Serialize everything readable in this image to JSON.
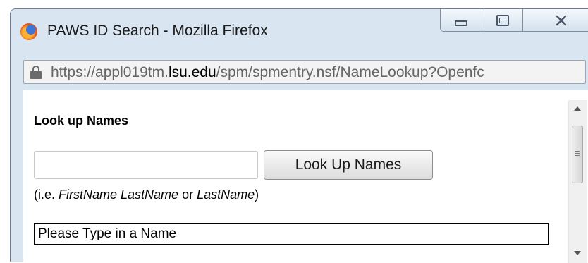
{
  "window": {
    "title": "PAWS ID Search - Mozilla Firefox",
    "icon": "firefox-icon"
  },
  "address_bar": {
    "url_prefix": "https://appl019tm.",
    "url_host": "lsu.edu",
    "url_path": "/spm/spmentry.nsf/NameLookup?Openfc",
    "icon": "lock-icon"
  },
  "page": {
    "heading": "Look up Names",
    "search_value": "",
    "button_label": "Look Up Names",
    "hint": {
      "prefix": "(i.e. ",
      "first_last": "FirstName LastName",
      "or": " or ",
      "last": "LastName",
      "suffix": ")"
    },
    "status": "Please Type in a Name"
  }
}
